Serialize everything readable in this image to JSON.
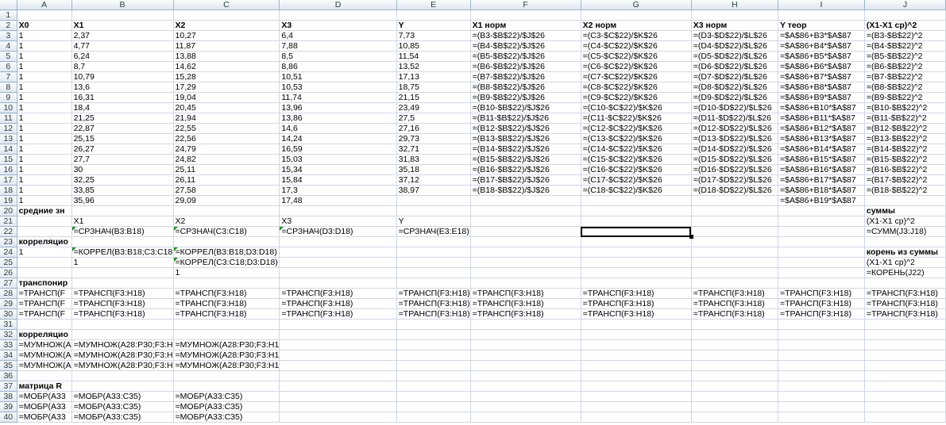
{
  "columns": [
    "A",
    "B",
    "C",
    "D",
    "E",
    "F",
    "G",
    "H",
    "I",
    "J"
  ],
  "rows": [
    {
      "n": "1",
      "c": [
        "",
        "",
        "",
        "",
        "",
        "",
        "",
        "",
        "",
        ""
      ]
    },
    {
      "n": "2",
      "b": [
        0,
        1,
        2,
        3,
        4,
        5,
        6,
        7,
        8,
        9
      ],
      "c": [
        "X0",
        "X1",
        "X2",
        "X3",
        "Y",
        "X1 норм",
        "X2 норм",
        "X3 норм",
        "Y теор",
        "(X1-X1 ср)^2"
      ]
    },
    {
      "n": "3",
      "c": [
        "1",
        "2,37",
        "10,27",
        "6,4",
        "7,73",
        "=(B3-$B$22)/$J$26",
        "=(C3-$C$22)/$K$26",
        "=(D3-$D$22)/$L$26",
        "=$A$86+B3*$A$87",
        "=(B3-$B$22)^2"
      ]
    },
    {
      "n": "4",
      "c": [
        "1",
        "4,77",
        "11,87",
        "7,88",
        "10,85",
        "=(B4-$B$22)/$J$26",
        "=(C4-$C$22)/$K$26",
        "=(D4-$D$22)/$L$26",
        "=$A$86+B4*$A$87",
        "=(B4-$B$22)^2"
      ]
    },
    {
      "n": "5",
      "c": [
        "1",
        "6,24",
        "13,88",
        "8,5",
        "11,54",
        "=(B5-$B$22)/$J$26",
        "=(C5-$C$22)/$K$26",
        "=(D5-$D$22)/$L$26",
        "=$A$86+B5*$A$87",
        "=(B5-$B$22)^2"
      ]
    },
    {
      "n": "6",
      "c": [
        "1",
        "8,7",
        "14,62",
        "8,86",
        "13,52",
        "=(B6-$B$22)/$J$26",
        "=(C6-$C$22)/$K$26",
        "=(D6-$D$22)/$L$26",
        "=$A$86+B6*$A$87",
        "=(B6-$B$22)^2"
      ]
    },
    {
      "n": "7",
      "c": [
        "1",
        "10,79",
        "15,28",
        "10,51",
        "17,13",
        "=(B7-$B$22)/$J$26",
        "=(C7-$C$22)/$K$26",
        "=(D7-$D$22)/$L$26",
        "=$A$86+B7*$A$87",
        "=(B7-$B$22)^2"
      ]
    },
    {
      "n": "8",
      "c": [
        "1",
        "13,6",
        "17,29",
        "10,53",
        "18,75",
        "=(B8-$B$22)/$J$26",
        "=(C8-$C$22)/$K$26",
        "=(D8-$D$22)/$L$26",
        "=$A$86+B8*$A$87",
        "=(B8-$B$22)^2"
      ]
    },
    {
      "n": "9",
      "c": [
        "1",
        "16,31",
        "19,04",
        "11,74",
        "21,15",
        "=(B9-$B$22)/$J$26",
        "=(C9-$C$22)/$K$26",
        "=(D9-$D$22)/$L$26",
        "=$A$86+B9*$A$87",
        "=(B9-$B$22)^2"
      ]
    },
    {
      "n": "10",
      "c": [
        "1",
        "18,4",
        "20,45",
        "13,96",
        "23,49",
        "=(B10-$B$22)/$J$26",
        "=(C10-$C$22)/$K$26",
        "=(D10-$D$22)/$L$26",
        "=$A$86+B10*$A$87",
        "=(B10-$B$22)^2"
      ]
    },
    {
      "n": "11",
      "c": [
        "1",
        "21,25",
        "21,94",
        "13,86",
        "27,5",
        "=(B11-$B$22)/$J$26",
        "=(C11-$C$22)/$K$26",
        "=(D11-$D$22)/$L$26",
        "=$A$86+B11*$A$87",
        "=(B11-$B$22)^2"
      ]
    },
    {
      "n": "12",
      "c": [
        "1",
        "22,87",
        "22,55",
        "14,6",
        "27,16",
        "=(B12-$B$22)/$J$26",
        "=(C12-$C$22)/$K$26",
        "=(D12-$D$22)/$L$26",
        "=$A$86+B12*$A$87",
        "=(B12-$B$22)^2"
      ]
    },
    {
      "n": "13",
      "c": [
        "1",
        "25,15",
        "22,56",
        "14,24",
        "29,73",
        "=(B13-$B$22)/$J$26",
        "=(C13-$C$22)/$K$26",
        "=(D13-$D$22)/$L$26",
        "=$A$86+B13*$A$87",
        "=(B13-$B$22)^2"
      ]
    },
    {
      "n": "14",
      "c": [
        "1",
        "26,27",
        "24,79",
        "16,59",
        "32,71",
        "=(B14-$B$22)/$J$26",
        "=(C14-$C$22)/$K$26",
        "=(D14-$D$22)/$L$26",
        "=$A$86+B14*$A$87",
        "=(B14-$B$22)^2"
      ]
    },
    {
      "n": "15",
      "c": [
        "1",
        "27,7",
        "24,82",
        "15,03",
        "31,83",
        "=(B15-$B$22)/$J$26",
        "=(C15-$C$22)/$K$26",
        "=(D15-$D$22)/$L$26",
        "=$A$86+B15*$A$87",
        "=(B15-$B$22)^2"
      ]
    },
    {
      "n": "16",
      "c": [
        "1",
        "30",
        "25,11",
        "15,34",
        "35,18",
        "=(B16-$B$22)/$J$26",
        "=(C16-$C$22)/$K$26",
        "=(D16-$D$22)/$L$26",
        "=$A$86+B16*$A$87",
        "=(B16-$B$22)^2"
      ]
    },
    {
      "n": "17",
      "c": [
        "1",
        "32,25",
        "26,11",
        "15,84",
        "37,12",
        "=(B17-$B$22)/$J$26",
        "=(C17-$C$22)/$K$26",
        "=(D17-$D$22)/$L$26",
        "=$A$86+B17*$A$87",
        "=(B17-$B$22)^2"
      ]
    },
    {
      "n": "18",
      "c": [
        "1",
        "33,85",
        "27,58",
        "17,3",
        "38,97",
        "=(B18-$B$22)/$J$26",
        "=(C18-$C$22)/$K$26",
        "=(D18-$D$22)/$L$26",
        "=$A$86+B18*$A$87",
        "=(B18-$B$22)^2"
      ]
    },
    {
      "n": "19",
      "c": [
        "1",
        "35,96",
        "29,09",
        "17,48",
        "",
        "",
        "",
        "",
        "=$A$86+B19*$A$87",
        ""
      ]
    },
    {
      "n": "20",
      "b": [
        0,
        9
      ],
      "c": [
        "средние зн",
        "",
        "",
        "",
        "",
        "",
        "",
        "",
        "",
        "суммы"
      ]
    },
    {
      "n": "21",
      "c": [
        "",
        "X1",
        "X2",
        "X3",
        "Y",
        "",
        "",
        "",
        "",
        "(X1-X1 ср)^2"
      ]
    },
    {
      "n": "22",
      "t": [
        1,
        2,
        3
      ],
      "c": [
        "",
        "=СРЗНАЧ(B3:B18)",
        "=СРЗНАЧ(C3:C18)",
        "=СРЗНАЧ(D3:D18)",
        "=СРЗНАЧ(E3:E18)",
        "",
        "",
        "",
        "",
        "=СУММ(J3:J18)"
      ]
    },
    {
      "n": "23",
      "b": [
        0
      ],
      "c": [
        "корреляцио",
        "",
        "",
        "",
        "",
        "",
        "",
        "",
        "",
        ""
      ]
    },
    {
      "n": "24",
      "t": [
        1,
        2
      ],
      "c": [
        "1",
        "=КОРРЕЛ(B3:B18;C3:C18",
        "=КОРРЕЛ(B3:B18;D3:D18)",
        "",
        "",
        "",
        "",
        "",
        "",
        "корень из суммы"
      ],
      "b": [
        9
      ]
    },
    {
      "n": "25",
      "t": [
        2
      ],
      "c": [
        "",
        "    1",
        "=КОРРЕЛ(C3:C18;D3:D18)",
        "",
        "",
        "",
        "",
        "",
        "",
        "(X1-X1 ср)^2"
      ]
    },
    {
      "n": "26",
      "c": [
        "",
        "",
        "1",
        "",
        "",
        "",
        "",
        "",
        "",
        "=КОРЕНЬ(J22)"
      ]
    },
    {
      "n": "27",
      "b": [
        0
      ],
      "c": [
        "транспонир",
        "",
        "",
        "",
        "",
        "",
        "",
        "",
        "",
        ""
      ]
    },
    {
      "n": "28",
      "c": [
        "=ТРАНСП(F",
        "=ТРАНСП(F3:H18)",
        "=ТРАНСП(F3:H18)",
        "=ТРАНСП(F3:H18)",
        "=ТРАНСП(F3:H18)",
        "=ТРАНСП(F3:H18)",
        "=ТРАНСП(F3:H18)",
        "=ТРАНСП(F3:H18)",
        "=ТРАНСП(F3:H18)",
        "=ТРАНСП(F3:H18)"
      ]
    },
    {
      "n": "29",
      "c": [
        "=ТРАНСП(F",
        "=ТРАНСП(F3:H18)",
        "=ТРАНСП(F3:H18)",
        "=ТРАНСП(F3:H18)",
        "=ТРАНСП(F3:H18)",
        "=ТРАНСП(F3:H18)",
        "=ТРАНСП(F3:H18)",
        "=ТРАНСП(F3:H18)",
        "=ТРАНСП(F3:H18)",
        "=ТРАНСП(F3:H18)"
      ]
    },
    {
      "n": "30",
      "c": [
        "=ТРАНСП(F",
        "=ТРАНСП(F3:H18)",
        "=ТРАНСП(F3:H18)",
        "=ТРАНСП(F3:H18)",
        "=ТРАНСП(F3:H18)",
        "=ТРАНСП(F3:H18)",
        "=ТРАНСП(F3:H18)",
        "=ТРАНСП(F3:H18)",
        "=ТРАНСП(F3:H18)",
        "=ТРАНСП(F3:H18)"
      ]
    },
    {
      "n": "31",
      "c": [
        "",
        "",
        "",
        "",
        "",
        "",
        "",
        "",
        "",
        ""
      ]
    },
    {
      "n": "32",
      "b": [
        0
      ],
      "c": [
        "корреляцио",
        "",
        "",
        "",
        "",
        "",
        "",
        "",
        "",
        ""
      ]
    },
    {
      "n": "33",
      "c": [
        "=МУМНОЖ(A",
        "=МУМНОЖ(A28:P30;F3:H",
        "=МУМНОЖ(A28:P30;F3:H1",
        "",
        "",
        "",
        "",
        "",
        "",
        ""
      ]
    },
    {
      "n": "34",
      "c": [
        "=МУМНОЖ(A",
        "=МУМНОЖ(A28:P30;F3:H",
        "=МУМНОЖ(A28:P30;F3:H1",
        "",
        "",
        "",
        "",
        "",
        "",
        ""
      ]
    },
    {
      "n": "35",
      "c": [
        "=МУМНОЖ(A",
        "=МУМНОЖ(A28:P30;F3:H",
        "=МУМНОЖ(A28:P30;F3:H1",
        "",
        "",
        "",
        "",
        "",
        "",
        ""
      ]
    },
    {
      "n": "36",
      "c": [
        "",
        "",
        "",
        "",
        "",
        "",
        "",
        "",
        "",
        ""
      ]
    },
    {
      "n": "37",
      "b": [
        0
      ],
      "c": [
        " матрица R",
        "",
        "",
        "",
        "",
        "",
        "",
        "",
        "",
        ""
      ]
    },
    {
      "n": "38",
      "c": [
        "=МОБР(A33",
        "=МОБР(A33:C35)",
        "=МОБР(A33:C35)",
        "",
        "",
        "",
        "",
        "",
        "",
        ""
      ]
    },
    {
      "n": "39",
      "c": [
        "=МОБР(A33",
        "=МОБР(A33:C35)",
        "=МОБР(A33:C35)",
        "",
        "",
        "",
        "",
        "",
        "",
        ""
      ]
    },
    {
      "n": "40",
      "c": [
        "=МОБР(A33",
        "=МОБР(A33:C35)",
        "=МОБР(A33:C35)",
        "",
        "",
        "",
        "",
        "",
        "",
        ""
      ]
    }
  ],
  "selection": {
    "cell": "G22",
    "column": "G",
    "row": "22"
  }
}
